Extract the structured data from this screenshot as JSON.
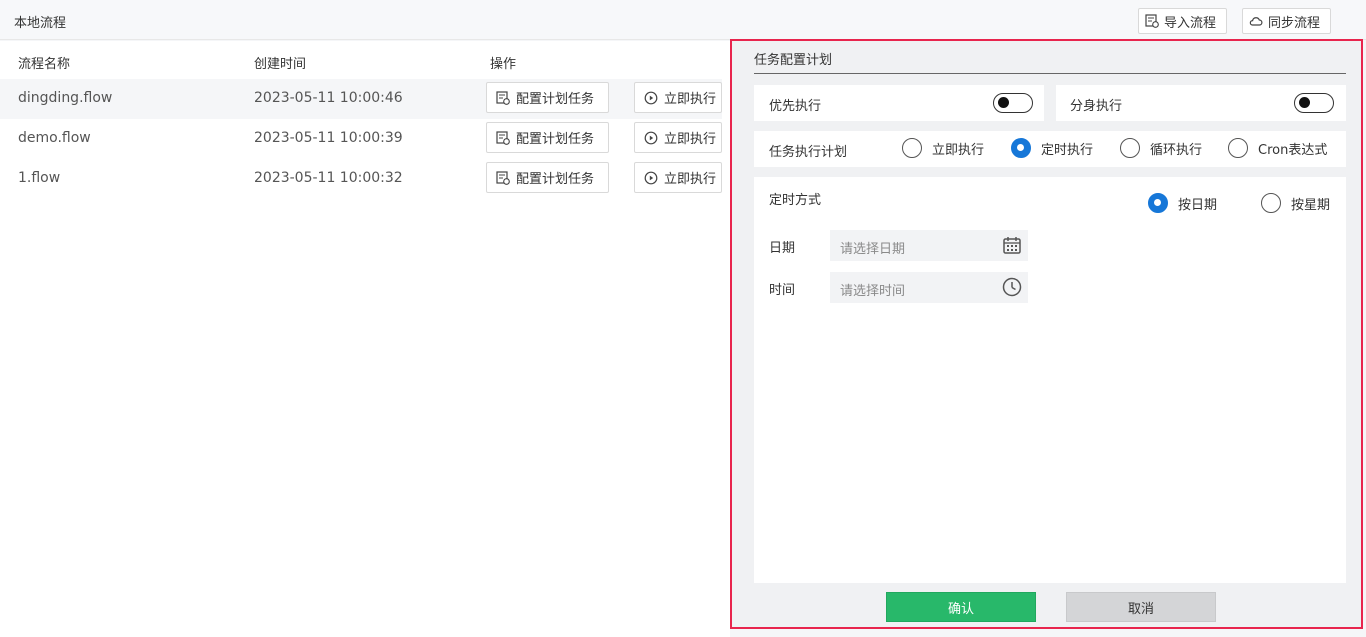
{
  "header": {
    "title": "本地流程",
    "import_label": "导入流程",
    "sync_label": "同步流程"
  },
  "table": {
    "columns": [
      "流程名称",
      "创建时间",
      "操作"
    ],
    "rows": [
      {
        "name": "dingding.flow",
        "created": "2023-05-11 10:00:46"
      },
      {
        "name": "demo.flow",
        "created": "2023-05-11 10:00:39"
      },
      {
        "name": "1.flow",
        "created": "2023-05-11 10:00:32"
      }
    ],
    "config_label": "配置计划任务",
    "run_label": "立即执行"
  },
  "panel": {
    "title": "任务配置计划",
    "priority_label": "优先执行",
    "clone_label": "分身执行",
    "plan_label": "任务执行计划",
    "plan_options": [
      "立即执行",
      "定时执行",
      "循环执行",
      "Cron表达式"
    ],
    "plan_selected": "定时执行",
    "timing_label": "定时方式",
    "timing_options": [
      "按日期",
      "按星期"
    ],
    "timing_selected": "按日期",
    "date_label": "日期",
    "date_placeholder": "请选择日期",
    "time_label": "时间",
    "time_placeholder": "请选择时间",
    "confirm_label": "确认",
    "cancel_label": "取消"
  },
  "colors": {
    "accent": "#1677d8",
    "confirm": "#28b86a",
    "highlight_border": "#e8254d"
  }
}
